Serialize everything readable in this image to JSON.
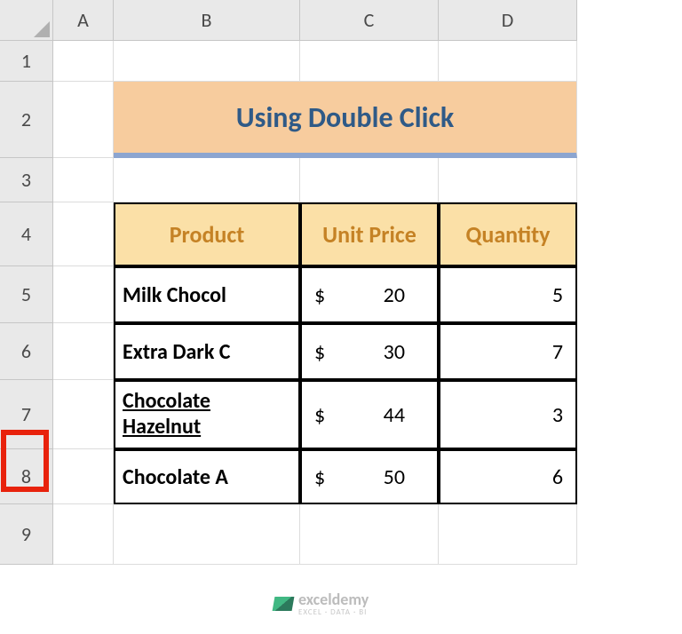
{
  "columns": [
    "A",
    "B",
    "C",
    "D"
  ],
  "rows": [
    "1",
    "2",
    "3",
    "4",
    "5",
    "6",
    "7",
    "8",
    "9"
  ],
  "title": "Using Double Click",
  "headers": {
    "product": "Product",
    "unit_price": "Unit Price",
    "quantity": "Quantity"
  },
  "data": [
    {
      "product": "Milk Chocol",
      "currency": "$",
      "price": "20",
      "qty": "5"
    },
    {
      "product": "Extra Dark C",
      "currency": "$",
      "price": "30",
      "qty": "7"
    },
    {
      "product": "Chocolate Hazelnut",
      "currency": "$",
      "price": "44",
      "qty": "3"
    },
    {
      "product": "Chocolate A",
      "currency": "$",
      "price": "50",
      "qty": "6"
    }
  ],
  "watermark": {
    "title": "exceldemy",
    "subtitle": "EXCEL · DATA · BI"
  }
}
